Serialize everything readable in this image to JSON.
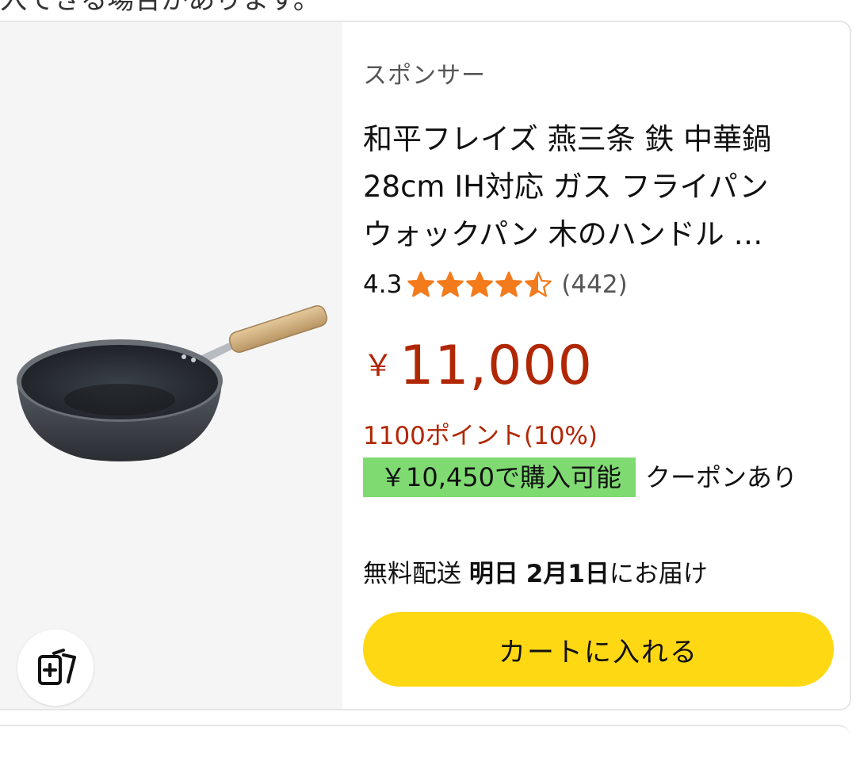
{
  "top_text": "入できる場合があります。",
  "sponsored_label": "スポンサー",
  "title_lines": [
    "和平フレイズ 燕三条 鉄 中華鍋",
    "28cm IH対応 ガス フライパン",
    "ウォックパン 木のハンドル …"
  ],
  "rating": {
    "value": "4.3",
    "stars": 4.3,
    "count": "(442)"
  },
  "price": {
    "symbol": "￥",
    "amount": "11,000"
  },
  "points": "1100ポイント(10%)",
  "coupon": {
    "badge": "￥10,450で購入可能",
    "note": "クーポンあり"
  },
  "delivery": {
    "prefix": "無料配送",
    "when": "明日",
    "date": "2月1日",
    "suffix": "にお届け"
  },
  "cart_button": "カートに入れる",
  "colors": {
    "price": "#b12704",
    "stars": "#f47b1c",
    "coupon_badge": "#7fda72",
    "cart_button": "#ffd814"
  },
  "icons": {
    "star": "star-icon",
    "add_to_list": "add-to-list-icon"
  }
}
